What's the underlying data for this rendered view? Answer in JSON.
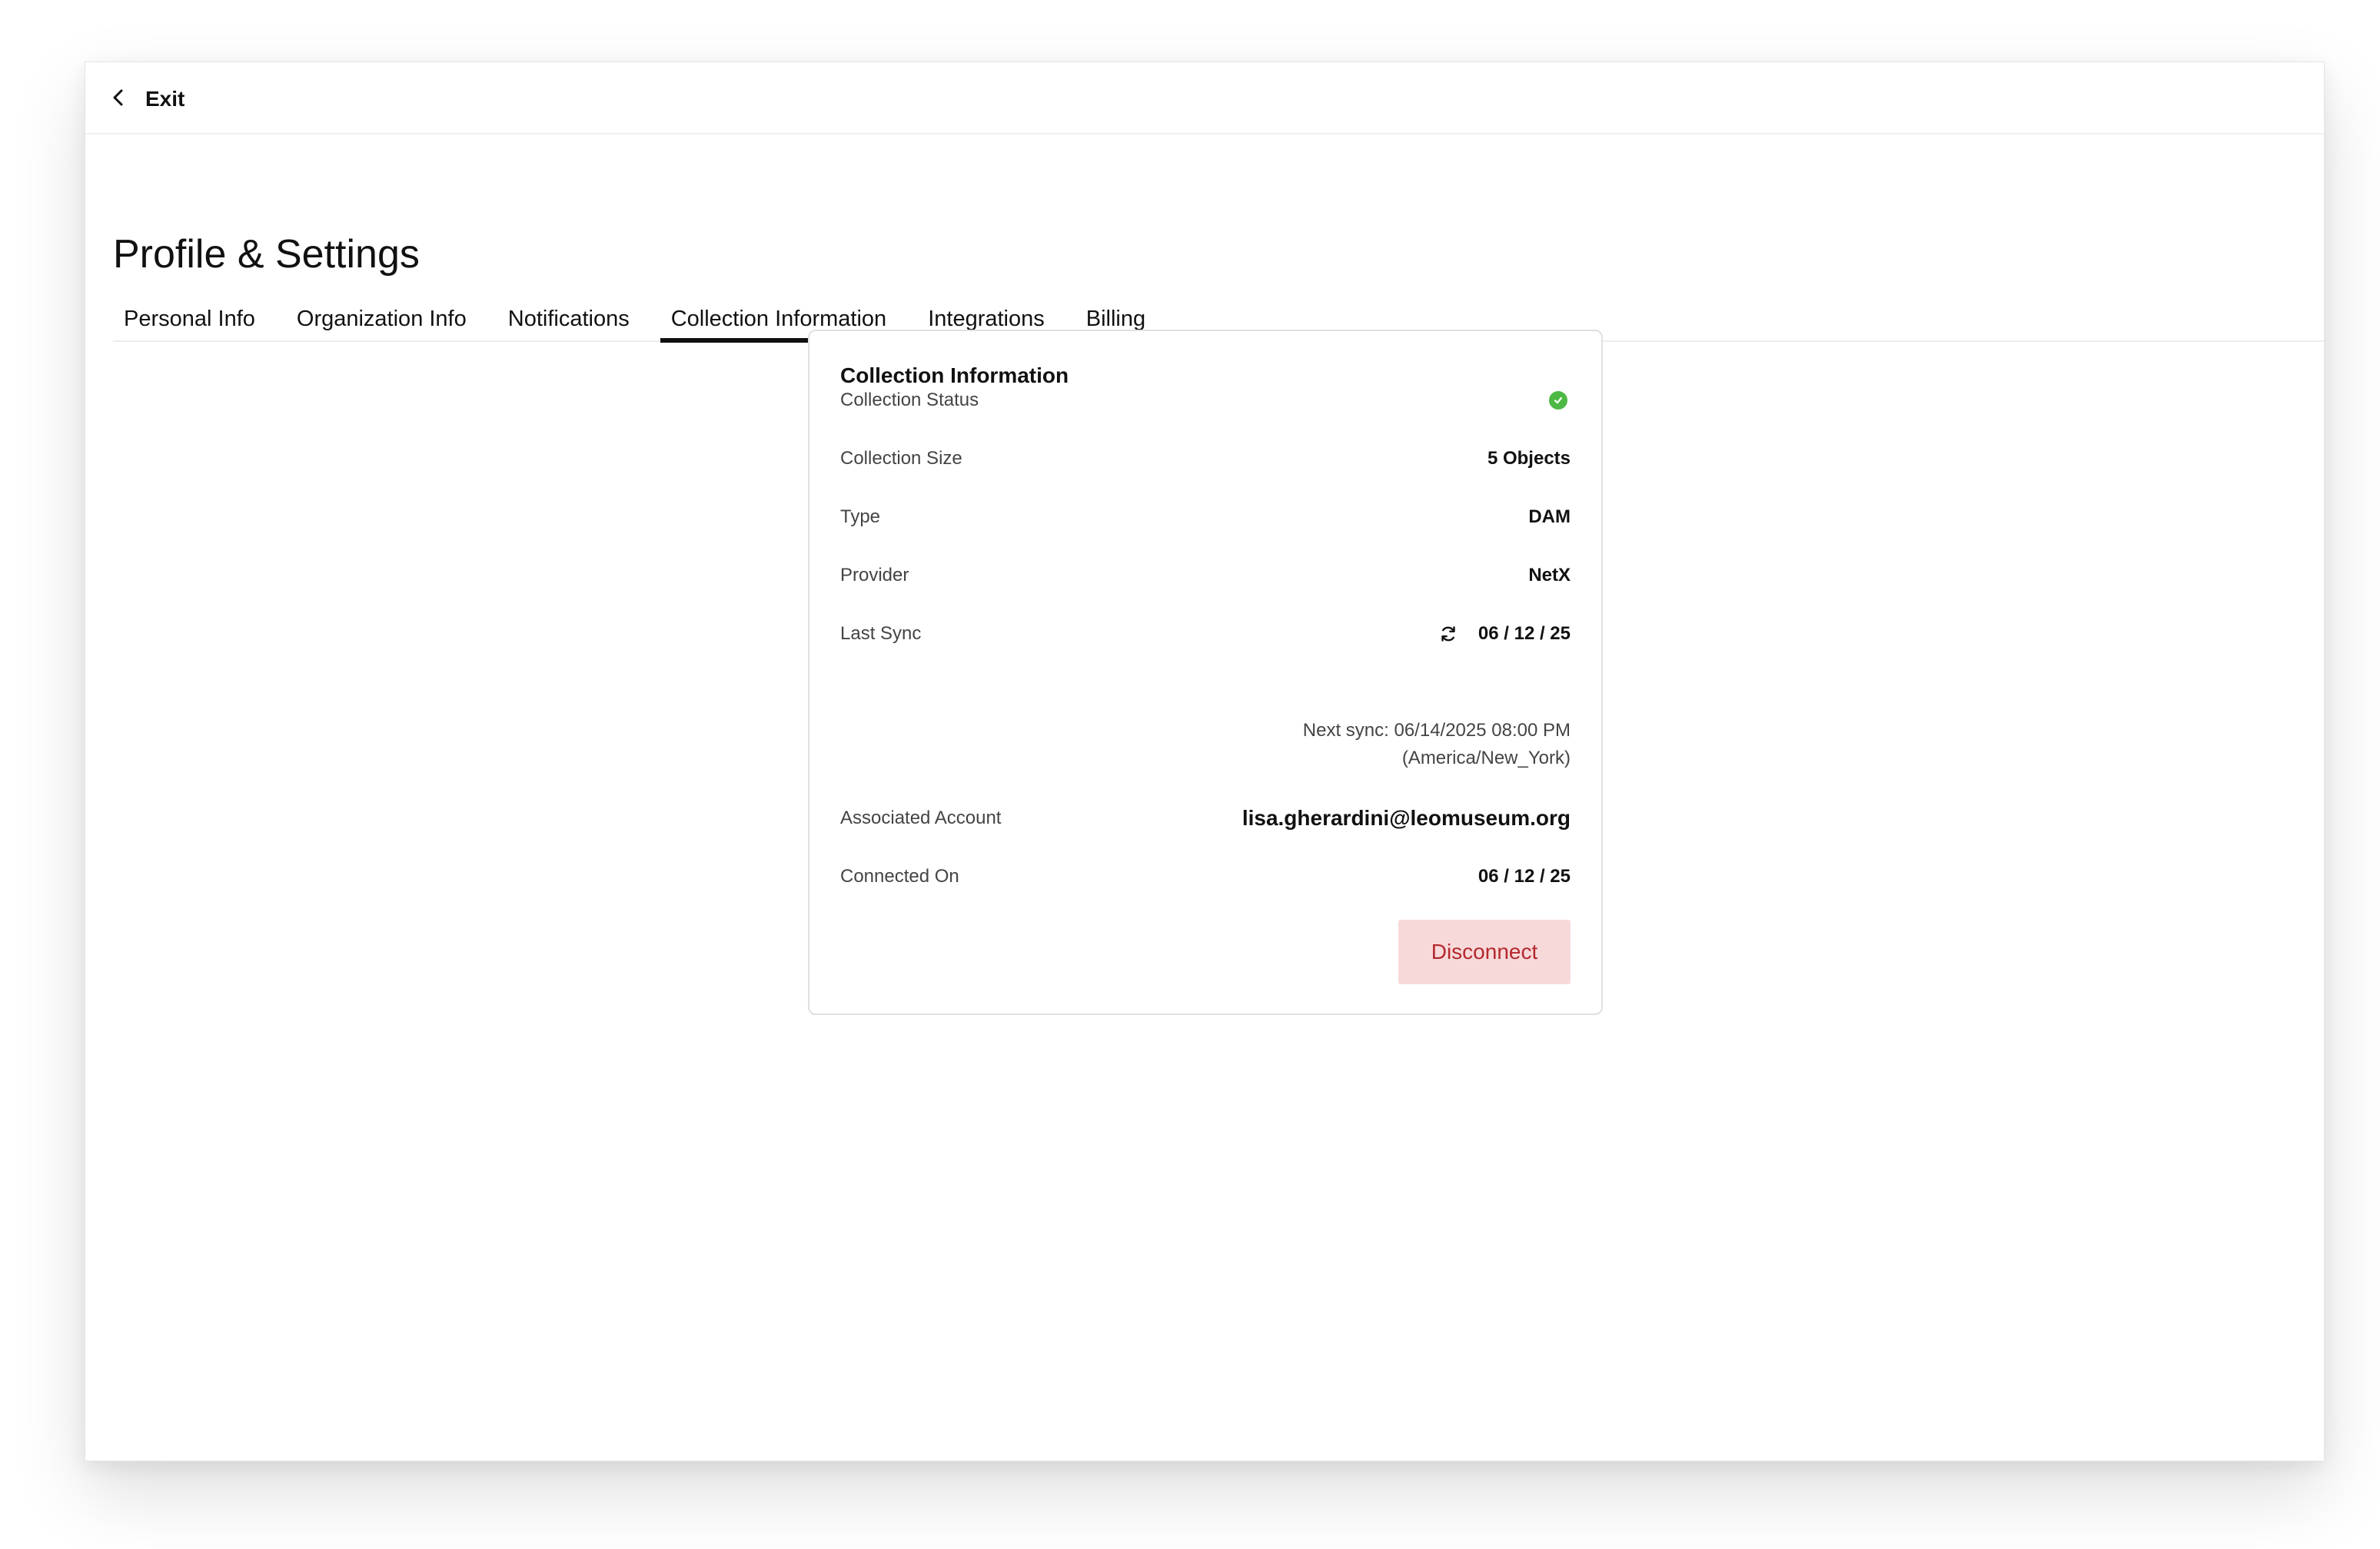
{
  "topbar": {
    "exit_label": "Exit",
    "exit_icon": "chevron-left-icon"
  },
  "page": {
    "title": "Profile & Settings"
  },
  "tabs": [
    {
      "label": "Personal Info",
      "active": false
    },
    {
      "label": "Organization Info",
      "active": false
    },
    {
      "label": "Notifications",
      "active": false
    },
    {
      "label": "Collection Information",
      "active": true
    },
    {
      "label": "Integrations",
      "active": false
    },
    {
      "label": "Billing",
      "active": false
    }
  ],
  "card": {
    "title": "Collection Information",
    "collection_status": {
      "label": "Collection Status",
      "status": "connected",
      "icon": "check-circle-icon"
    },
    "collection_size": {
      "label": "Collection Size",
      "value": "5 Objects"
    },
    "type": {
      "label": "Type",
      "value": "DAM"
    },
    "provider": {
      "label": "Provider",
      "value": "NetX"
    },
    "last_sync": {
      "label": "Last Sync",
      "value": "06 / 12 / 25",
      "icon": "refresh-icon"
    },
    "next_sync": {
      "line1": "Next sync: 06/14/2025 08:00 PM",
      "line2": "(America/New_York)"
    },
    "associated_account": {
      "label": "Associated Account",
      "value": "lisa.gherardini@leomuseum.org"
    },
    "connected_on": {
      "label": "Connected On",
      "value": "06 / 12 / 25"
    },
    "disconnect_label": "Disconnect"
  },
  "colors": {
    "status_green": "#4cb944",
    "disconnect_bg": "#f8d9da",
    "disconnect_text": "#b3282d",
    "active_tab_underline": "#111111"
  }
}
